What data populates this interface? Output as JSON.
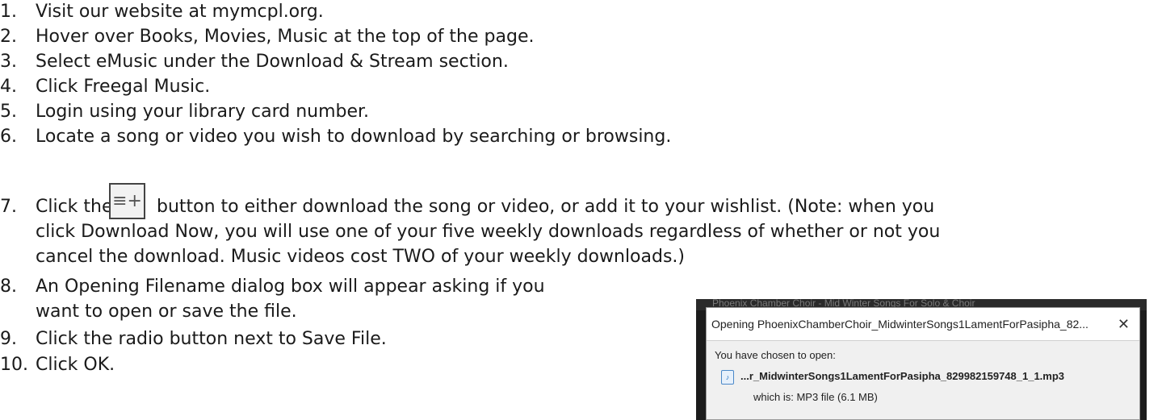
{
  "steps": [
    {
      "num": "1.",
      "text": "Visit our website at mymcpl.org."
    },
    {
      "num": "2.",
      "text": "Hover over Books, Movies, Music at the top of the page."
    },
    {
      "num": "3.",
      "text": "Select eMusic under the Download & Stream section."
    },
    {
      "num": "4.",
      "text": "Click Freegal Music."
    },
    {
      "num": "5.",
      "text": "Login using your library card number."
    },
    {
      "num": "6.",
      "text": "Locate a song or video you wish to download by searching or browsing."
    },
    {
      "num": "7.",
      "text_before": "Click the",
      "text_after": "button to either download the song or video, or add it to your wishlist. (Note: when you",
      "cont1": "click Download Now, you will use one of your five weekly downloads regardless of whether or not you",
      "cont2": "cancel the download. Music videos cost TWO of your weekly downloads.)",
      "button_glyph": "≡+"
    },
    {
      "num": "8.",
      "text": "An Opening Filename dialog box will appear asking if you",
      "cont1": "want to open or save the file."
    },
    {
      "num": "9.",
      "text": "Click the radio button next to Save File."
    },
    {
      "num": "10.",
      "text": "Click OK."
    }
  ],
  "dialog": {
    "background_title": "Phoenix Chamber Choir - Mid Winter Songs For Solo & Choir",
    "title": "Opening PhoenixChamberChoir_MidwinterSongs1LamentForPasipha_82...",
    "close_glyph": "✕",
    "chosen_label": "You have chosen to open:",
    "filename": "...r_MidwinterSongs1LamentForPasipha_829982159748_1_1.mp3",
    "which_is": "which is:  MP3 file (6.1 MB)"
  }
}
